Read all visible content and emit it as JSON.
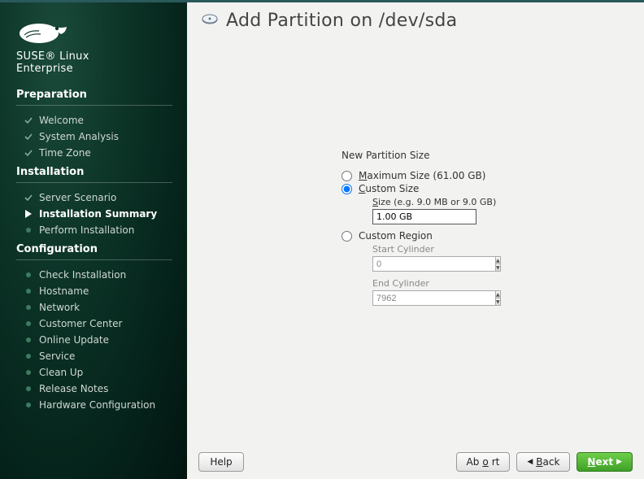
{
  "brand": {
    "line1": "SUSE® Linux",
    "line2": "Enterprise"
  },
  "sections": {
    "preparation": {
      "title": "Preparation",
      "items": [
        "Welcome",
        "System Analysis",
        "Time Zone"
      ]
    },
    "installation": {
      "title": "Installation",
      "items": [
        "Server Scenario",
        "Installation Summary",
        "Perform Installation"
      ]
    },
    "configuration": {
      "title": "Configuration",
      "items": [
        "Check Installation",
        "Hostname",
        "Network",
        "Customer Center",
        "Online Update",
        "Service",
        "Clean Up",
        "Release Notes",
        "Hardware Configuration"
      ]
    }
  },
  "page": {
    "title": "Add Partition on /dev/sda",
    "legend": "New Partition Size",
    "max_label_pre": "M",
    "max_label_post": "aximum Size (61.00 GB)",
    "custom_size_pre": "C",
    "custom_size_post": "ustom Size",
    "size_label_pre": "S",
    "size_label_post": "ize (e.g. 9.0 MB or 9.0 GB)",
    "size_value": "1.00 GB",
    "custom_region": "Custom Region",
    "start_cyl": "Start Cylinder",
    "start_val": "0",
    "end_cyl": "End Cylinder",
    "end_val": "7962"
  },
  "buttons": {
    "help": "Help",
    "abort_pre": "Ab",
    "abort_u": "o",
    "abort_post": "rt",
    "back_u": "B",
    "back_post": "ack",
    "next_u": "N",
    "next_post": "ext"
  }
}
